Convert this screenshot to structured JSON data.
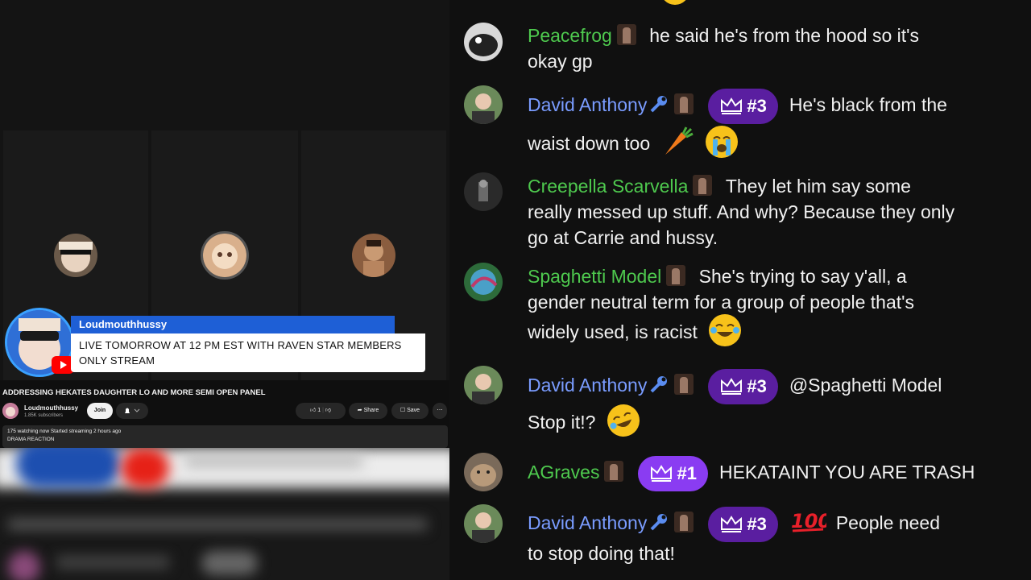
{
  "video": {
    "overlay": {
      "name": "Loudmouthhussy",
      "message": "LIVE TOMORROW AT 12 PM EST WITH RAVEN STAR MEMBERS ONLY STREAM"
    },
    "title": "ADDRESSING HEKATES DAUGHTER LO AND MORE SEMI OPEN PANEL",
    "channel": {
      "name": "Loudmouthhussy",
      "subscribers": "1.85K subscribers"
    },
    "buttons": {
      "join": "Join",
      "like_count": "1",
      "share": "Share",
      "save": "Save"
    },
    "description": {
      "stats": "175 watching now  Started streaming 2 hours ago",
      "tag": "DRAMA REACTION"
    }
  },
  "chat": {
    "messages": [
      {
        "author": "Peacefrog",
        "color": "green",
        "line1": "he said he's from the hood so it's",
        "line2": "okay gp"
      },
      {
        "author": "David Anthony",
        "color": "blue",
        "member": "#3",
        "line1": "He's black from the",
        "line2": "waist down too",
        "emoji2": [
          "carrot",
          "loudly-crying"
        ]
      },
      {
        "author": "Creepella Scarvella",
        "color": "green",
        "line1": "They let him say some",
        "line2": "really messed up stuff. And why? Because they only",
        "line3": "go at Carrie and hussy."
      },
      {
        "author": "Spaghetti Model",
        "color": "green",
        "line1": "She's trying to say y'all, a",
        "line2": "gender neutral term for a group of people that's",
        "line3": "widely used, is racist",
        "emoji3": [
          "joy"
        ]
      },
      {
        "author": "David Anthony",
        "color": "blue",
        "member": "#3",
        "line1": "@Spaghetti Model",
        "line2": "Stop it!?",
        "emoji2": [
          "rofl"
        ]
      },
      {
        "author": "AGraves",
        "color": "green",
        "member": "#1",
        "line1": "HEKATAINT YOU ARE TRASH"
      },
      {
        "author": "David Anthony",
        "color": "blue",
        "member": "#3",
        "line1": "People need",
        "line2": "to stop doing that!",
        "emoji1": [
          "hundred"
        ]
      }
    ]
  },
  "colors": {
    "green_author": "#4ec94e",
    "blue_author": "#7a9cff",
    "member_badge": "#5a1ea0",
    "overlay_blue": "#1e5fd6"
  }
}
